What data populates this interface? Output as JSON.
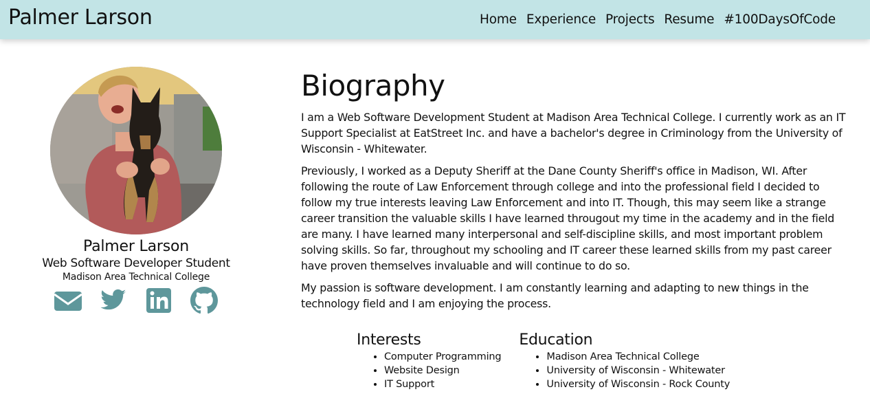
{
  "header": {
    "brand": "Palmer Larson",
    "nav": [
      "Home",
      "Experience",
      "Projects",
      "Resume",
      "#100DaysOfCode"
    ]
  },
  "profile": {
    "name": "Palmer Larson",
    "title": "Web Software Developer Student",
    "school": "Madison Area Technical College",
    "social_icons": [
      "envelope-icon",
      "twitter-icon",
      "linkedin-icon",
      "github-icon"
    ],
    "icon_color": "#5e979b"
  },
  "bio": {
    "heading": "Biography",
    "paragraphs": [
      "I am a Web Software Development Student at Madison Area Technical College. I currently work as an IT Support Specialist at EatStreet Inc. and have a bachelor's degree in Criminology from the University of Wisconsin - Whitewater.",
      "Previously, I worked as a Deputy Sheriff at the Dane County Sheriff's office in Madison, WI. After following the route of Law Enforcement through college and into the professional field I decided to follow my true interests leaving Law Enforcement and into IT. Though, this may seem like a strange career transition the valuable skills I have learned througout my time in the academy and in the field are many. I have learned many interpersonal and self-discipline skills, and most important problem solving skills. So far, throughout my schooling and IT career these learned skills from my past career have proven themselves invaluable and will continue to do so.",
      "My passion is software development. I am constantly learning and adapting to new things in the technology field and I am enjoying the process."
    ]
  },
  "interests": {
    "heading": "Interests",
    "items": [
      "Computer Programming",
      "Website Design",
      "IT Support"
    ]
  },
  "education": {
    "heading": "Education",
    "items": [
      "Madison Area Technical College",
      "University of Wisconsin - Whitewater",
      "University of Wisconsin - Rock County"
    ]
  },
  "colors": {
    "navbar_bg": "#c2e4e6",
    "text": "#111111"
  }
}
